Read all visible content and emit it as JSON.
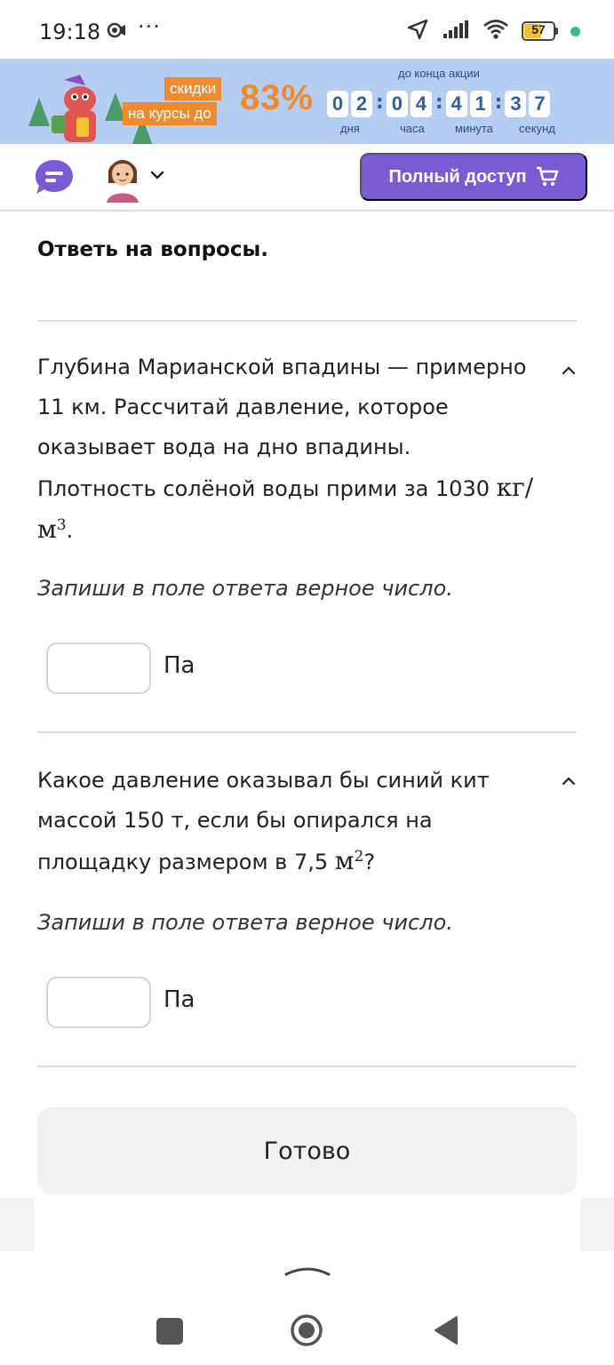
{
  "status_bar": {
    "time": "19:18",
    "dots": "···",
    "battery": "57"
  },
  "banner": {
    "tag_top": "скидки",
    "tag_bottom": "на курсы до",
    "percent": "83%",
    "timer_caption": "до конца акции",
    "digits": [
      "0",
      "2",
      "0",
      "4",
      "4",
      "1",
      "3",
      "7"
    ],
    "units": [
      "дня",
      "часа",
      "минута",
      "секунд"
    ]
  },
  "header": {
    "cta_label": "Полный доступ"
  },
  "page": {
    "heading": "Ответь на вопросы."
  },
  "questions": [
    {
      "text": "Глубина Марианской впадины — примерно 11 км. Рассчитай давление, которое оказывает вода на дно впадины. Плотность солёной воды прими за 1030",
      "math": "кг/м",
      "math_sup": "3",
      "math_tail": ".",
      "hint": "Запиши в поле ответа верное число.",
      "unit": "Па",
      "answer_value": ""
    },
    {
      "text": "Какое давление оказывал бы синий кит массой 150 т, если бы опирался на площадку размером в 7,5",
      "math": "м",
      "math_sup": "2",
      "math_tail": "?",
      "hint": "Запиши в поле ответа верное число.",
      "unit": "Па",
      "answer_value": ""
    }
  ],
  "done_button": "Готово",
  "colors": {
    "accent": "#7a5bd6",
    "banner_bg": "#b5cdf3",
    "promo_orange": "#f08a2a"
  }
}
